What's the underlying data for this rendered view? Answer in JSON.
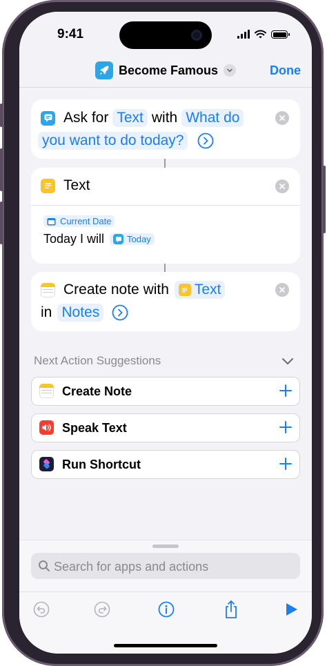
{
  "status_bar": {
    "time": "9:41"
  },
  "nav": {
    "title": "Become Famous",
    "done_label": "Done",
    "app_icon": "rocket-icon"
  },
  "actions": {
    "ask": {
      "verb": "Ask for",
      "type_token": "Text",
      "with": "with",
      "prompt_line1": "What do",
      "prompt_line2": "you want to do today?"
    },
    "text": {
      "title": "Text",
      "date_token": "Current Date",
      "body_text": "Today I will",
      "var_token": "Today"
    },
    "note": {
      "verb": "Create note with",
      "input_token": "Text",
      "in": "in",
      "app_token": "Notes"
    }
  },
  "suggestions": {
    "heading": "Next Action Suggestions",
    "items": [
      {
        "label": "Create Note",
        "icon": "notes-icon"
      },
      {
        "label": "Speak Text",
        "icon": "speaker-icon"
      },
      {
        "label": "Run Shortcut",
        "icon": "shortcuts-icon"
      }
    ]
  },
  "search": {
    "placeholder": "Search for apps and actions"
  },
  "colors": {
    "accent": "#1a7ef5",
    "background": "#f2f2f7",
    "rocket": "#2ea6e6",
    "text_icon": "#f9c52b",
    "speak_icon": "#ff3b30"
  }
}
